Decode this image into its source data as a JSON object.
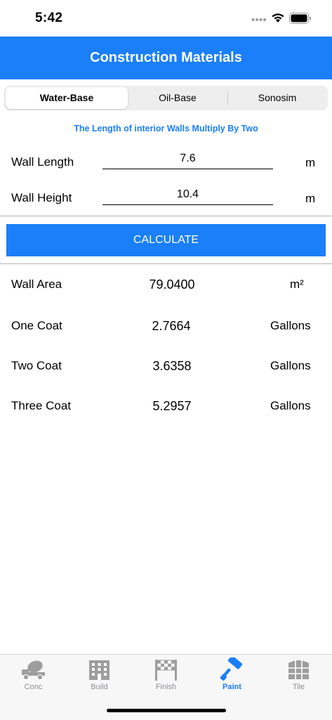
{
  "status": {
    "time": "5:42"
  },
  "nav": {
    "title": "Construction Materials"
  },
  "segments": {
    "items": [
      "Water-Base",
      "Oil-Base",
      "Sonosim"
    ],
    "selected": "Water-Base"
  },
  "hint": "The Length of interior Walls Multiply By Two",
  "inputs": {
    "length": {
      "label": "Wall Length",
      "value": "7.6",
      "unit": "m"
    },
    "height": {
      "label": "Wall Height",
      "value": "10.4",
      "unit": "m"
    }
  },
  "calculate_label": "CALCULATE",
  "results": [
    {
      "label": "Wall Area",
      "value": "79.0400",
      "unit": "m²"
    },
    {
      "label": "One Coat",
      "value": "2.7664",
      "unit": "Gallons"
    },
    {
      "label": "Two Coat",
      "value": "3.6358",
      "unit": "Gallons"
    },
    {
      "label": "Three Coat",
      "value": "5.2957",
      "unit": "Gallons"
    }
  ],
  "tabs": [
    {
      "label": "Conc",
      "icon": "concrete-mixer-icon"
    },
    {
      "label": "Build",
      "icon": "building-icon"
    },
    {
      "label": "Finish",
      "icon": "finish-flag-icon"
    },
    {
      "label": "Paint",
      "icon": "paint-roller-icon",
      "active": true
    },
    {
      "label": "Tile",
      "icon": "tile-icon"
    }
  ],
  "colors": {
    "accent": "#1a7ff8",
    "inactive_tab": "#8e8e93"
  }
}
